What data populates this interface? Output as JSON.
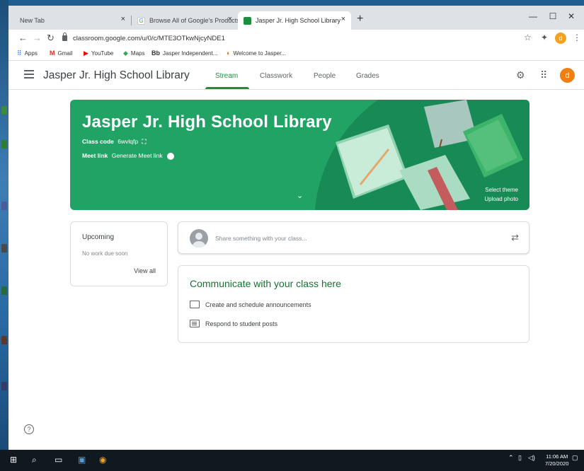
{
  "browser": {
    "tabs": [
      {
        "label": "New Tab"
      },
      {
        "label": "Browse All of Google's Products"
      },
      {
        "label": "Jasper Jr. High School Library"
      }
    ],
    "url": "classroom.google.com/u/0/c/MTE3OTkwNjcyNDE1",
    "profile_initial": "d",
    "bookmarks": [
      {
        "label": "Apps"
      },
      {
        "label": "Gmail"
      },
      {
        "label": "YouTube"
      },
      {
        "label": "Maps"
      },
      {
        "label": "Jasper Independent..."
      },
      {
        "label": "Welcome to Jasper..."
      }
    ]
  },
  "header": {
    "title": "Jasper Jr. High School Library",
    "tabs": [
      "Stream",
      "Classwork",
      "People",
      "Grades"
    ],
    "active_tab": "Stream",
    "avatar_initial": "d"
  },
  "banner": {
    "title": "Jasper Jr. High School Library",
    "class_code_label": "Class code",
    "class_code": "6wvlqfp",
    "meet_link_label": "Meet link",
    "meet_link_action": "Generate Meet link",
    "select_theme": "Select theme",
    "upload_photo": "Upload photo",
    "color": "#21a366"
  },
  "upcoming": {
    "title": "Upcoming",
    "subtitle": "No work due soon",
    "link": "View all"
  },
  "share": {
    "placeholder": "Share something with your class..."
  },
  "communicate": {
    "title": "Communicate with your class here",
    "items": [
      "Create and schedule announcements",
      "Respond to student posts"
    ]
  },
  "taskbar": {
    "time": "11:06 AM",
    "date": "7/20/2020"
  }
}
